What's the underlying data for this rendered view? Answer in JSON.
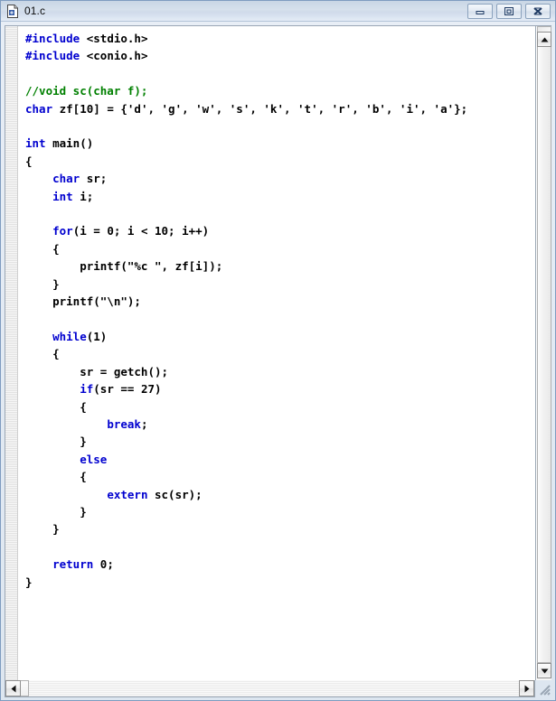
{
  "window": {
    "title": "01.c",
    "icon": "c-file-icon",
    "controls": [
      {
        "name": "minimize-button",
        "glyph": "minimize-icon",
        "label": "Minimize"
      },
      {
        "name": "restore-button",
        "glyph": "restore-icon",
        "label": "Restore"
      },
      {
        "name": "close-button",
        "glyph": "close-icon",
        "label": "Close"
      }
    ]
  },
  "editor": {
    "language": "c",
    "colors": {
      "keyword": "#0000cf",
      "comment": "#008000",
      "plain": "#000000",
      "background": "#ffffff",
      "titlebar": "#cfdaea"
    },
    "code_lines": [
      [
        {
          "t": "#include",
          "c": "kw"
        },
        {
          "t": " <stdio.h>",
          "c": "pl"
        }
      ],
      [
        {
          "t": "#include",
          "c": "kw"
        },
        {
          "t": " <conio.h>",
          "c": "pl"
        }
      ],
      [
        {
          "t": "",
          "c": "pl"
        }
      ],
      [
        {
          "t": "//void sc(char f);",
          "c": "cm"
        }
      ],
      [
        {
          "t": "char",
          "c": "kw"
        },
        {
          "t": " zf[10] = {'d', 'g', 'w', 's', 'k', 't', 'r', 'b', 'i', 'a'};",
          "c": "pl"
        }
      ],
      [
        {
          "t": "",
          "c": "pl"
        }
      ],
      [
        {
          "t": "int",
          "c": "kw"
        },
        {
          "t": " main()",
          "c": "pl"
        }
      ],
      [
        {
          "t": "{",
          "c": "pl"
        }
      ],
      [
        {
          "t": "    ",
          "c": "pl"
        },
        {
          "t": "char",
          "c": "kw"
        },
        {
          "t": " sr;",
          "c": "pl"
        }
      ],
      [
        {
          "t": "    ",
          "c": "pl"
        },
        {
          "t": "int",
          "c": "kw"
        },
        {
          "t": " i;",
          "c": "pl"
        }
      ],
      [
        {
          "t": "",
          "c": "pl"
        }
      ],
      [
        {
          "t": "    ",
          "c": "pl"
        },
        {
          "t": "for",
          "c": "kw"
        },
        {
          "t": "(i = 0; i < 10; i++)",
          "c": "pl"
        }
      ],
      [
        {
          "t": "    {",
          "c": "pl"
        }
      ],
      [
        {
          "t": "        printf(\"%c \", zf[i]);",
          "c": "pl"
        }
      ],
      [
        {
          "t": "    }",
          "c": "pl"
        }
      ],
      [
        {
          "t": "    printf(\"\\n\");",
          "c": "pl"
        }
      ],
      [
        {
          "t": "",
          "c": "pl"
        }
      ],
      [
        {
          "t": "    ",
          "c": "pl"
        },
        {
          "t": "while",
          "c": "kw"
        },
        {
          "t": "(1)",
          "c": "pl"
        }
      ],
      [
        {
          "t": "    {",
          "c": "pl"
        }
      ],
      [
        {
          "t": "        sr = getch();",
          "c": "pl"
        }
      ],
      [
        {
          "t": "        ",
          "c": "pl"
        },
        {
          "t": "if",
          "c": "kw"
        },
        {
          "t": "(sr == 27)",
          "c": "pl"
        }
      ],
      [
        {
          "t": "        {",
          "c": "pl"
        }
      ],
      [
        {
          "t": "            ",
          "c": "pl"
        },
        {
          "t": "break",
          "c": "kw"
        },
        {
          "t": ";",
          "c": "pl"
        }
      ],
      [
        {
          "t": "        }",
          "c": "pl"
        }
      ],
      [
        {
          "t": "        ",
          "c": "pl"
        },
        {
          "t": "else",
          "c": "kw"
        }
      ],
      [
        {
          "t": "        {",
          "c": "pl"
        }
      ],
      [
        {
          "t": "            ",
          "c": "pl"
        },
        {
          "t": "extern",
          "c": "kw"
        },
        {
          "t": " sc(sr);",
          "c": "pl"
        }
      ],
      [
        {
          "t": "        }",
          "c": "pl"
        }
      ],
      [
        {
          "t": "    }",
          "c": "pl"
        }
      ],
      [
        {
          "t": "",
          "c": "pl"
        }
      ],
      [
        {
          "t": "    ",
          "c": "pl"
        },
        {
          "t": "return",
          "c": "kw"
        },
        {
          "t": " 0;",
          "c": "pl"
        }
      ],
      [
        {
          "t": "}",
          "c": "pl"
        }
      ]
    ]
  },
  "scrollbars": {
    "vertical": {
      "up_arrow": "scroll-up-icon",
      "down_arrow": "scroll-down-icon",
      "thumb": "vertical-scroll-thumb"
    },
    "horizontal": {
      "left_arrow": "scroll-left-icon",
      "right_arrow": "scroll-right-icon",
      "thumb": "horizontal-scroll-thumb"
    },
    "resize_grip": "resize-grip-icon"
  }
}
